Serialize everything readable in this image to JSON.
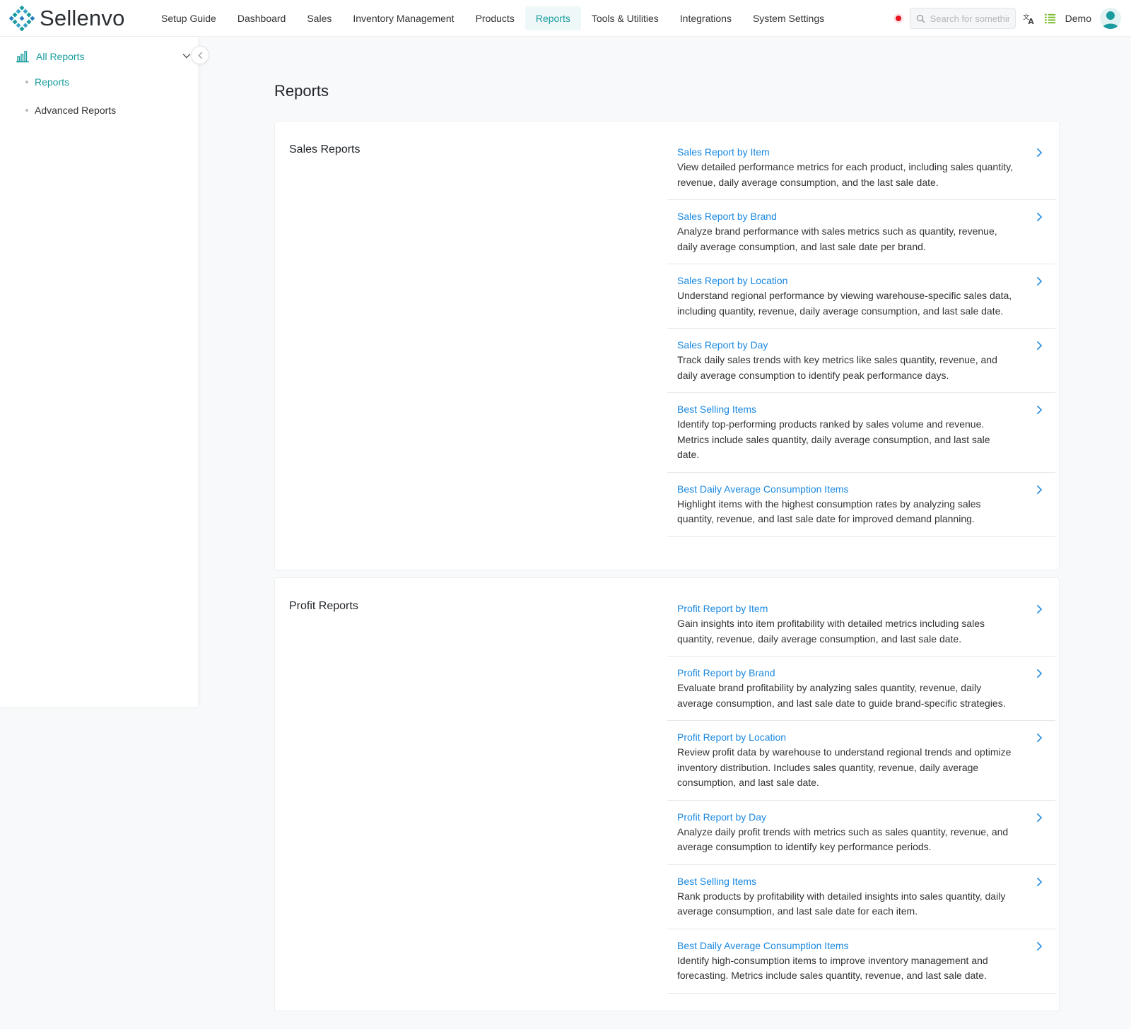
{
  "app": {
    "name": "Sellenvo"
  },
  "nav": [
    {
      "label": "Setup Guide"
    },
    {
      "label": "Dashboard"
    },
    {
      "label": "Sales"
    },
    {
      "label": "Inventory Management"
    },
    {
      "label": "Products"
    },
    {
      "label": "Reports",
      "active": true
    },
    {
      "label": "Tools & Utilities"
    },
    {
      "label": "Integrations"
    },
    {
      "label": "System Settings"
    }
  ],
  "header": {
    "search_placeholder": "Search for something",
    "user_name": "Demo",
    "accent_color": "#1a9c9e",
    "link_color": "#1a88e0",
    "record_color": "#e5141f"
  },
  "sidebar": {
    "header_label": "All Reports",
    "items": [
      {
        "label": "Reports",
        "active": true
      },
      {
        "label": "Advanced Reports"
      }
    ]
  },
  "page": {
    "title": "Reports"
  },
  "sections": [
    {
      "title": "Sales Reports",
      "items": [
        {
          "title": "Sales Report by Item",
          "desc": "View detailed performance metrics for each product, including sales quantity, revenue, daily average consumption, and the last sale date."
        },
        {
          "title": "Sales Report by Brand",
          "desc": "Analyze brand performance with sales metrics such as quantity, revenue, daily average consumption, and last sale date per brand."
        },
        {
          "title": "Sales Report by Location",
          "desc": "Understand regional performance by viewing warehouse-specific sales data, including quantity, revenue, daily average consumption, and last sale date."
        },
        {
          "title": "Sales Report by Day",
          "desc": "Track daily sales trends with key metrics like sales quantity, revenue, and daily average consumption to identify peak performance days."
        },
        {
          "title": "Best Selling Items",
          "desc": "Identify top-performing products ranked by sales volume and revenue. Metrics include sales quantity, daily average consumption, and last sale date."
        },
        {
          "title": "Best Daily Average Consumption Items",
          "desc": "Highlight items with the highest consumption rates by analyzing sales quantity, revenue, and last sale date for improved demand planning."
        }
      ]
    },
    {
      "title": "Profit Reports",
      "items": [
        {
          "title": "Profit Report by Item",
          "desc": "Gain insights into item profitability with detailed metrics including sales quantity, revenue, daily average consumption, and last sale date."
        },
        {
          "title": "Profit Report by Brand",
          "desc": "Evaluate brand profitability by analyzing sales quantity, revenue, daily average consumption, and last sale date to guide brand-specific strategies."
        },
        {
          "title": "Profit Report by Location",
          "desc": "Review profit data by warehouse to understand regional trends and optimize inventory distribution. Includes sales quantity, revenue, daily average consumption, and last sale date."
        },
        {
          "title": "Profit Report by Day",
          "desc": "Analyze daily profit trends with metrics such as sales quantity, revenue, and average consumption to identify key performance periods."
        },
        {
          "title": "Best Selling Items",
          "desc": "Rank products by profitability with detailed insights into sales quantity, daily average consumption, and last sale date for each item."
        },
        {
          "title": "Best Daily Average Consumption Items",
          "desc": "Identify high-consumption items to improve inventory management and forecasting. Metrics include sales quantity, revenue, and last sale date."
        }
      ]
    }
  ]
}
